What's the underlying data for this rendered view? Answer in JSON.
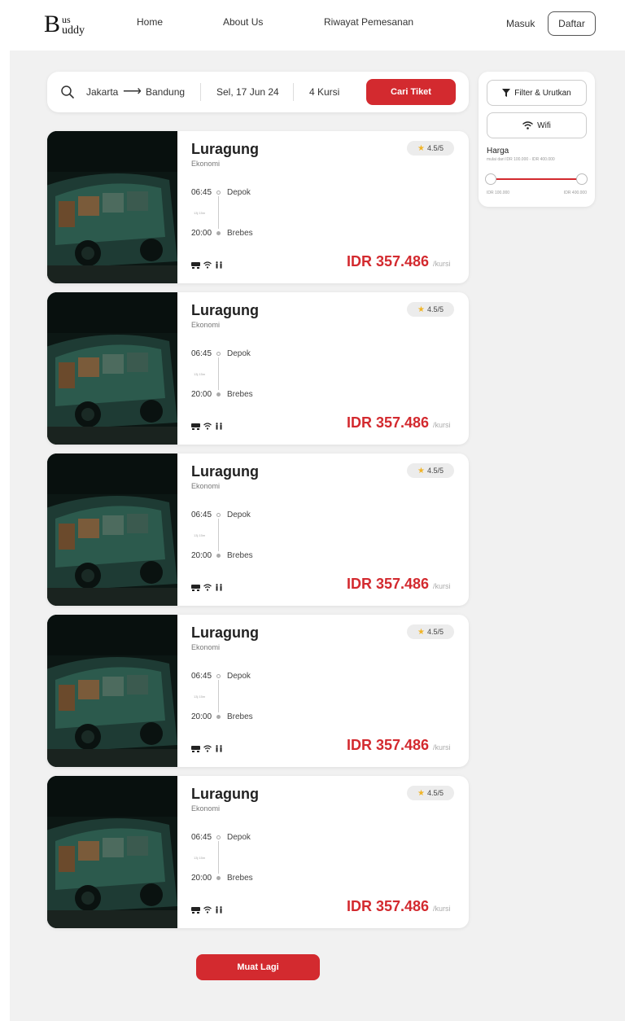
{
  "header": {
    "logo": {
      "initial": "B",
      "top": "us",
      "bottom": "uddy"
    },
    "nav": {
      "home": "Home",
      "about": "About Us",
      "history": "Riwayat Pemesanan"
    },
    "login_label": "Masuk",
    "register_label": "Daftar"
  },
  "search": {
    "icon": "search-icon",
    "from": "Jakarta",
    "arrow": "⟶",
    "to": "Bandung",
    "date": "Sel, 17 Jun 24",
    "seats": "4 Kursi",
    "button_label": "Cari Tiket"
  },
  "filter": {
    "filter_button_label": "Filter & Urutkan",
    "wifi_button_label": "Wifi",
    "price_label": "Harga",
    "price_range_text": "mulai dari IDR 100.000 - IDR 400.000",
    "price_min_label": "IDR 100.000",
    "price_max_label": "IDR 400.000",
    "price_min_value": 100000,
    "price_max_value": 400000
  },
  "tickets": [
    {
      "name": "Luragung",
      "class": "Ekonomi",
      "rating": "4.5/5",
      "dep_time": "06:45",
      "dep_city": "Depok",
      "duration": "13j 15m",
      "arr_time": "20:00",
      "arr_city": "Brebes",
      "facilities": [
        "bus-icon",
        "wifi-icon",
        "restroom-icon"
      ],
      "price": "IDR 357.486",
      "per": "/kursi"
    },
    {
      "name": "Luragung",
      "class": "Ekonomi",
      "rating": "4.5/5",
      "dep_time": "06:45",
      "dep_city": "Depok",
      "duration": "13j 15m",
      "arr_time": "20:00",
      "arr_city": "Brebes",
      "facilities": [
        "bus-icon",
        "wifi-icon",
        "restroom-icon"
      ],
      "price": "IDR 357.486",
      "per": "/kursi"
    },
    {
      "name": "Luragung",
      "class": "Ekonomi",
      "rating": "4.5/5",
      "dep_time": "06:45",
      "dep_city": "Depok",
      "duration": "13j 15m",
      "arr_time": "20:00",
      "arr_city": "Brebes",
      "facilities": [
        "bus-icon",
        "wifi-icon",
        "restroom-icon"
      ],
      "price": "IDR 357.486",
      "per": "/kursi"
    },
    {
      "name": "Luragung",
      "class": "Ekonomi",
      "rating": "4.5/5",
      "dep_time": "06:45",
      "dep_city": "Depok",
      "duration": "13j 15m",
      "arr_time": "20:00",
      "arr_city": "Brebes",
      "facilities": [
        "bus-icon",
        "wifi-icon",
        "restroom-icon"
      ],
      "price": "IDR 357.486",
      "per": "/kursi"
    },
    {
      "name": "Luragung",
      "class": "Ekonomi",
      "rating": "4.5/5",
      "dep_time": "06:45",
      "dep_city": "Depok",
      "duration": "13j 15m",
      "arr_time": "20:00",
      "arr_city": "Brebes",
      "facilities": [
        "bus-icon",
        "wifi-icon",
        "restroom-icon"
      ],
      "price": "IDR 357.486",
      "per": "/kursi"
    }
  ],
  "load_more_label": "Muat Lagi",
  "colors": {
    "accent": "#d32a2f",
    "background": "#f1f1f1",
    "star": "#f0b428"
  }
}
